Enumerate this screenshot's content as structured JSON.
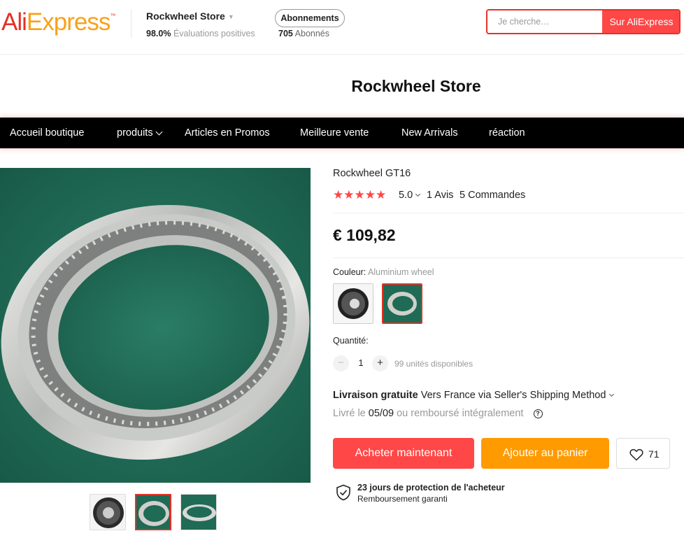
{
  "header": {
    "logo_ali": "Ali",
    "logo_express": "Express",
    "logo_tm": "™",
    "store_name": "Rockwheel Store",
    "rating_percent": "98.0%",
    "rating_label": "Évaluations positives",
    "follow_label": "Abonnements",
    "followers_count": "705",
    "followers_label": "Abonnés",
    "search_placeholder": "Je cherche…",
    "search_button": "Sur AliExpress"
  },
  "banner": {
    "title": "Rockwheel Store"
  },
  "nav": {
    "items": [
      {
        "label": "Accueil boutique"
      },
      {
        "label": "produits"
      },
      {
        "label": "Articles en Promos"
      },
      {
        "label": "Meilleure vente"
      },
      {
        "label": "New Arrivals"
      },
      {
        "label": "réaction"
      }
    ]
  },
  "product": {
    "title": "Rockwheel GT16",
    "stars": "★★★★★",
    "rating": "5.0",
    "reviews": "1 Avis",
    "orders": "5 Commandes",
    "price": "€ 109,82",
    "color_label": "Couleur:",
    "color_value": "Aluminium wheel",
    "quantity_label": "Quantité:",
    "quantity": "1",
    "qty_minus": "−",
    "qty_plus": "+",
    "stock": "99 unités disponibles",
    "shipping_free": "Livraison gratuite",
    "shipping_detail": "Vers France via Seller's Shipping Method",
    "delivery_prefix": "Livré le",
    "delivery_date": "05/09",
    "delivery_suffix": "ou remboursé intégralement",
    "help": "?",
    "buy_now": "Acheter maintenant",
    "add_cart": "Ajouter au panier",
    "wishlist_count": "71",
    "protection_title": "23 jours de protection de l'acheteur",
    "protection_sub": "Remboursement garanti"
  },
  "colors": {
    "brand_red": "#e43225",
    "buy_red": "#ff4747",
    "cart_orange": "#ff9a00",
    "nav_black": "#000000"
  }
}
